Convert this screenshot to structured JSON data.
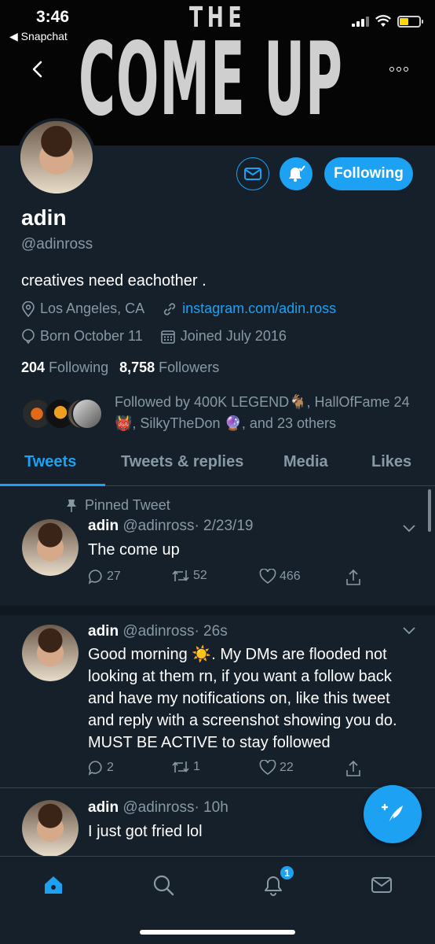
{
  "status_bar": {
    "time": "3:46",
    "back_app": "◀ Snapchat",
    "battery_color": "#ffd60a"
  },
  "banner": {
    "line1": "THE",
    "line2": "COME UP"
  },
  "profile": {
    "name": "adin",
    "handle": "@adinross",
    "bio": "creatives need eachother .",
    "location": "Los Angeles, CA",
    "website": "instagram.com/adin.ross",
    "birthday": "Born October 11",
    "joined": "Joined July 2016",
    "following_count": "204",
    "following_label": "Following",
    "followers_count": "8,758",
    "followers_label": "Followers",
    "follow_button_label": "Following",
    "followed_by_prefix": "Followed by 400K LEGEND",
    "followed_by_emoji1": "🐐",
    "followed_by_mid": ", HallOfFame 24",
    "followed_by_emoji2": "👹",
    "followed_by_mid2": ", SilkyTheDon",
    "followed_by_emoji3": "🔮",
    "followed_by_suffix": ", and 23 others"
  },
  "tabs": [
    {
      "label": "Tweets",
      "active": true
    },
    {
      "label": "Tweets & replies",
      "active": false
    },
    {
      "label": "Media",
      "active": false
    },
    {
      "label": "Likes",
      "active": false
    }
  ],
  "tweets": [
    {
      "pinned_label": "Pinned Tweet",
      "name": "adin",
      "handle": "@adinross",
      "time": "· 2/23/19",
      "text": "The come up",
      "replies": "27",
      "retweets": "52",
      "likes": "466"
    },
    {
      "name": "adin",
      "handle": "@adinross",
      "time": "· 26s",
      "text_before_emoji": "Good morning ",
      "emoji": "☀️",
      "text_after_emoji": ".  My DMs are flooded not looking at them rn, if you want a follow back and have my notifications on, like this tweet and reply with a screenshot showing you do.  MUST BE ACTIVE to stay followed",
      "replies": "2",
      "retweets": "1",
      "likes": "22"
    },
    {
      "name": "adin",
      "handle": "@adinross",
      "time": "· 10h",
      "text": "I just got fried lol"
    }
  ],
  "bottom_nav": {
    "notification_badge": "1"
  },
  "colors": {
    "accent": "#1da1f2",
    "background": "#15202b",
    "muted": "#8899a6",
    "divider": "#38444d"
  }
}
